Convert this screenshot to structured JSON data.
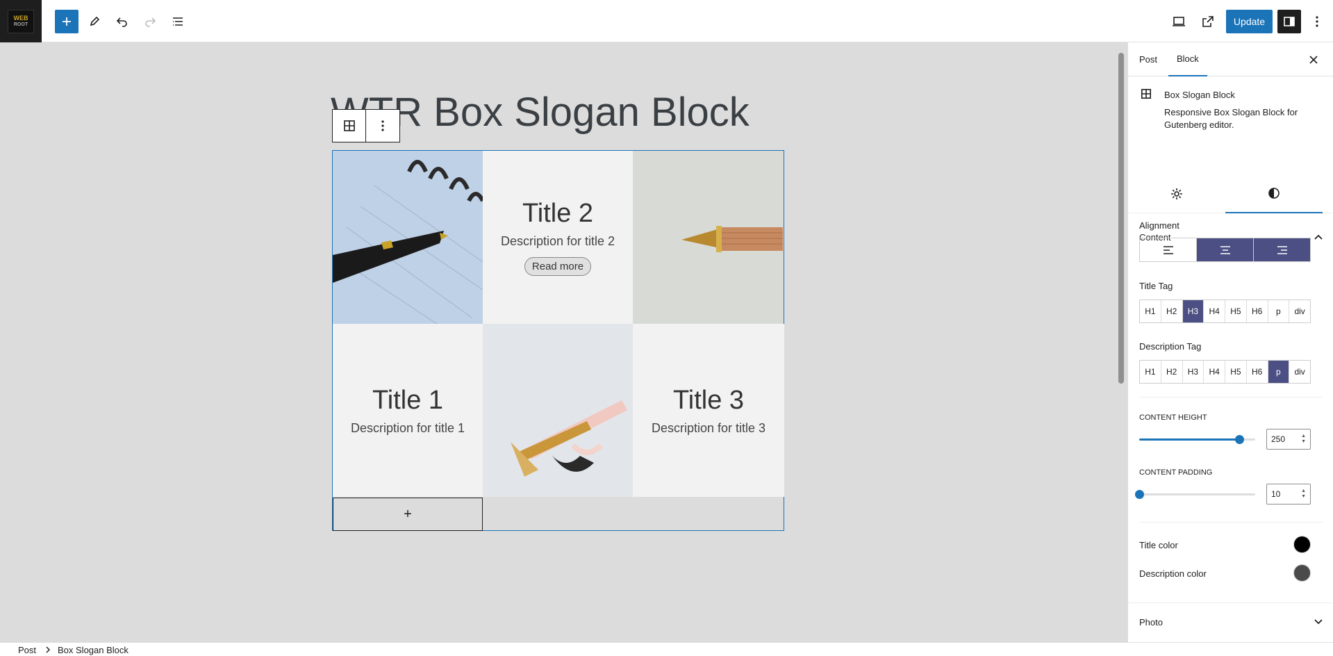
{
  "topbar": {
    "logo_text_1": "WEB",
    "logo_text_2": "ROOT",
    "update_label": "Update",
    "icons": [
      "plus-icon",
      "pencil-icon",
      "undo-icon",
      "redo-icon",
      "list-view-icon",
      "desktop-preview-icon",
      "external-link-icon",
      "sidebar-toggle-icon",
      "more-vertical-icon"
    ]
  },
  "editor": {
    "post_title": "WTR Box Slogan Block",
    "cells": [
      {
        "kind": "image",
        "desc": "notebook and pen"
      },
      {
        "kind": "text",
        "title": "Title 2",
        "description": "Description for title 2",
        "button": "Read more"
      },
      {
        "kind": "image",
        "desc": "fountain pen"
      },
      {
        "kind": "text",
        "title": "Title 1",
        "description": "Description for title 1"
      },
      {
        "kind": "image",
        "desc": "pink pens"
      },
      {
        "kind": "text",
        "title": "Title 3",
        "description": "Description for title 3"
      }
    ],
    "add_cell_label": "+"
  },
  "sidebar": {
    "tabs": [
      "Post",
      "Block"
    ],
    "active_tab": "Block",
    "block_name": "Box Slogan Block",
    "block_description": "Responsive Box Slogan Block for Gutenberg editor.",
    "content_panel": {
      "title": "Content",
      "alignment_label": "Alignment",
      "alignment_selected": "center",
      "title_tag_label": "Title Tag",
      "title_tags": [
        "H1",
        "H2",
        "H3",
        "H4",
        "H5",
        "H6",
        "p",
        "div"
      ],
      "title_tag_selected": "H3",
      "description_tag_label": "Description Tag",
      "description_tags": [
        "H1",
        "H2",
        "H3",
        "H4",
        "H5",
        "H6",
        "p",
        "div"
      ],
      "description_tag_selected": "p",
      "content_height_label": "CONTENT HEIGHT",
      "content_height_value": "250",
      "content_height_fraction": 0.86,
      "content_padding_label": "CONTENT PADDING",
      "content_padding_value": "10",
      "content_padding_fraction": 0.0,
      "title_color_label": "Title color",
      "title_color": "#000000",
      "description_color_label": "Description color",
      "description_color": "#4a4a4a"
    },
    "photo_panel_title": "Photo"
  },
  "footer": {
    "breadcrumb": [
      "Post",
      "Box Slogan Block"
    ]
  },
  "colors": {
    "accent": "#1b73b8",
    "selected_option": "#4b4f83"
  }
}
